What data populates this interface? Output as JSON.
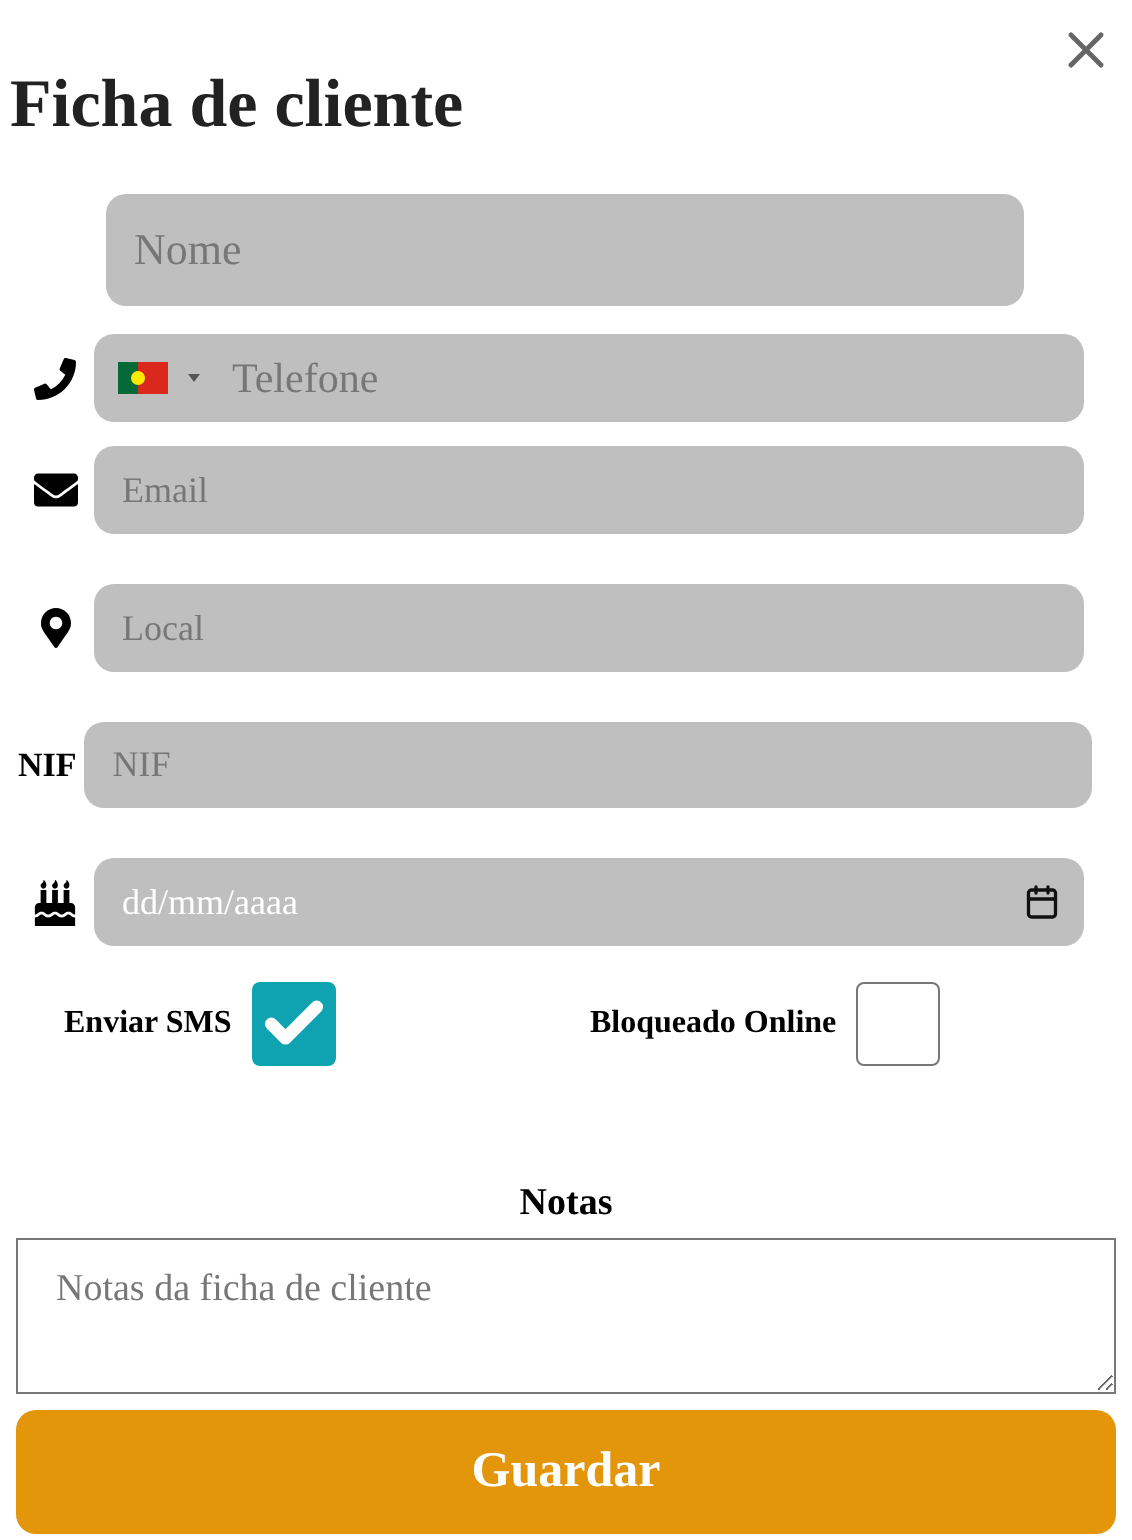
{
  "title": "Ficha de cliente",
  "fields": [
    {
      "kind": "name",
      "placeholder": "Nome"
    },
    {
      "kind": "phone",
      "placeholder": "Telefone"
    },
    {
      "kind": "email",
      "placeholder": "Email"
    },
    {
      "kind": "location",
      "placeholder": "Local"
    },
    {
      "kind": "nif",
      "label": "NIF",
      "placeholder": "NIF"
    },
    {
      "kind": "date",
      "placeholder": "dd/mm/aaaa"
    }
  ],
  "checkboxes": [
    {
      "label": "Enviar SMS",
      "checked": true
    },
    {
      "label": "Bloqueado Online",
      "checked": false
    }
  ],
  "notes": {
    "label": "Notas",
    "placeholder": "Notas da ficha de cliente"
  },
  "save_button": "Guardar"
}
